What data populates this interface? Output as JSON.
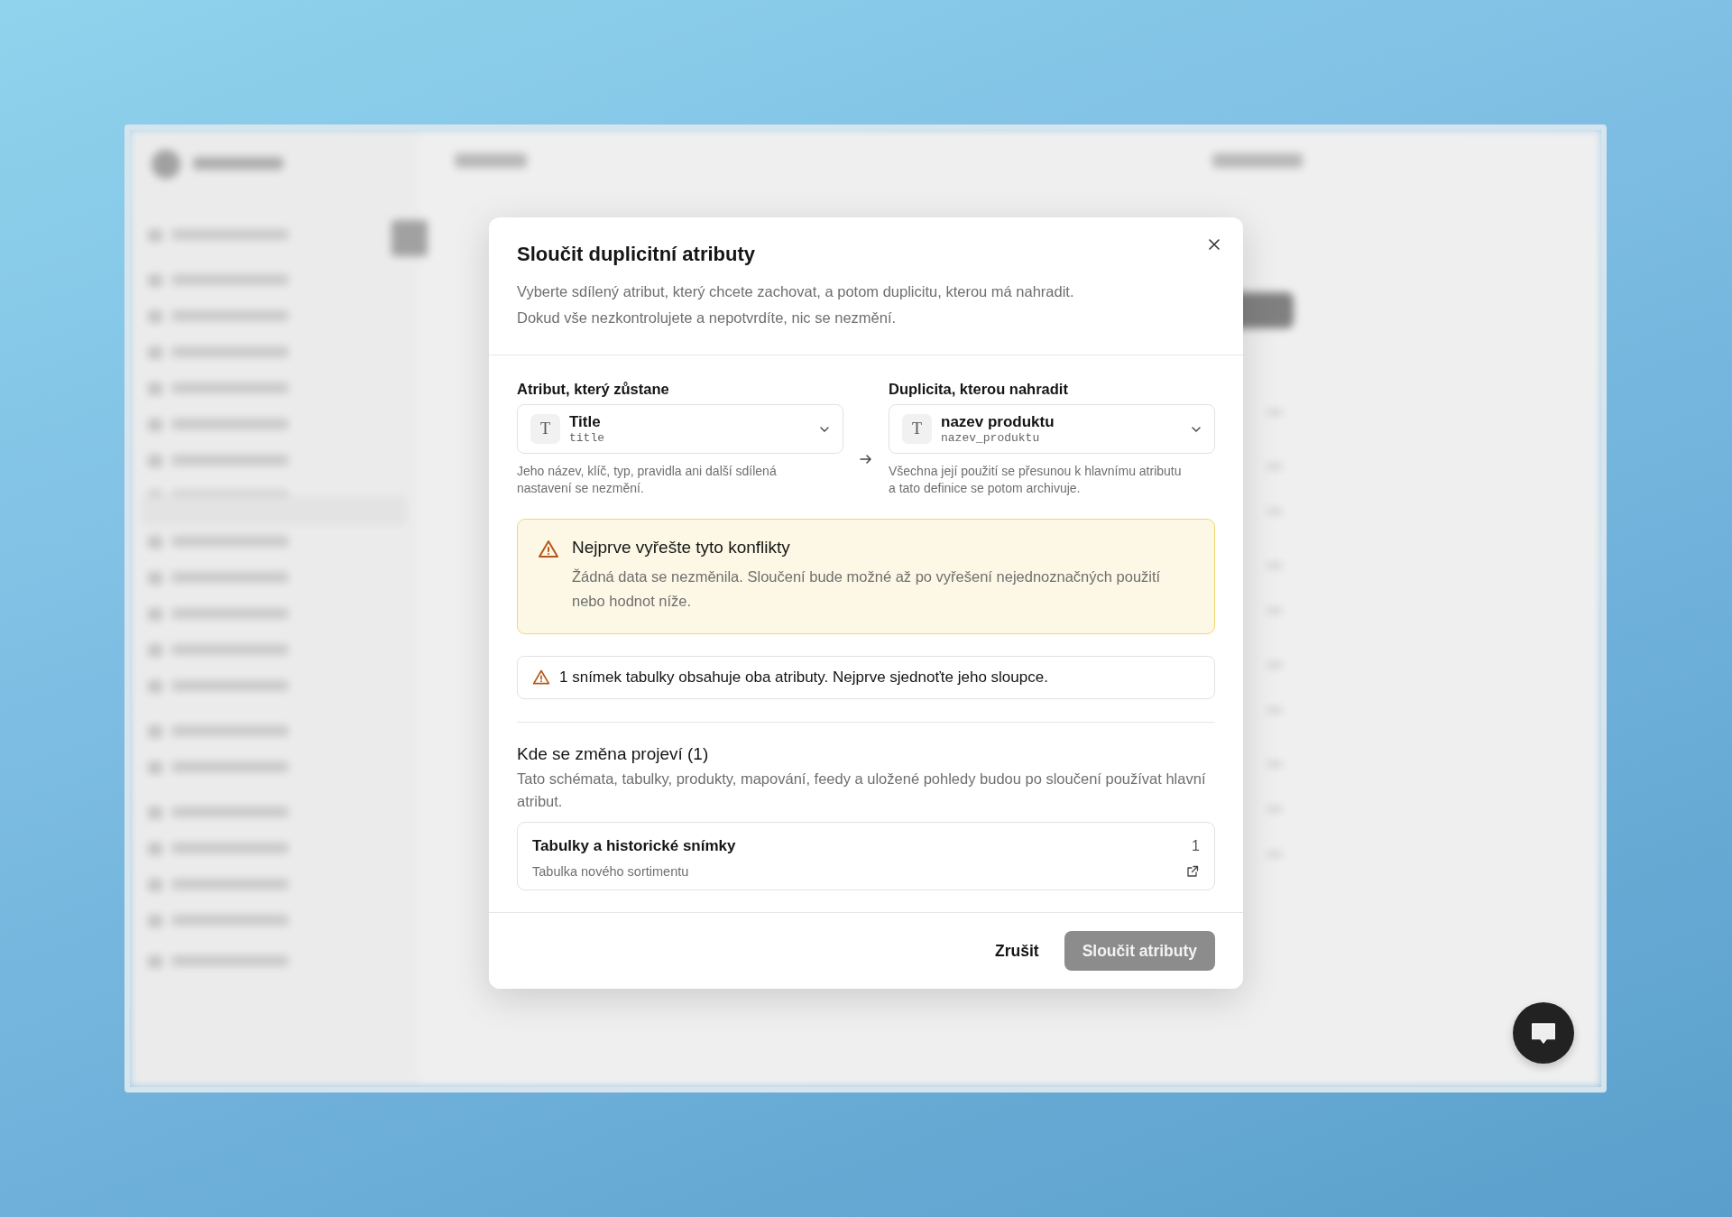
{
  "dialog": {
    "title": "Sloučit duplicitní atributy",
    "description": [
      "Vyberte sdílený atribut, který chcete zachovat, a potom duplicitu, kterou má nahradit.",
      "Dokud vše nezkontrolujete a nepotvrdíte, nic se nezmění."
    ],
    "fields": [
      {
        "label": "Atribut, který zůstane",
        "type_symbol": "T",
        "value": "Title",
        "key": "title",
        "hint": "Jeho název, klíč, typ, pravidla ani další sdílená nastavení se nezmění."
      },
      {
        "label": "Duplicita, kterou nahradit",
        "type_symbol": "T",
        "value": "nazev produktu",
        "key": "nazev_produktu",
        "hint": "Všechna její použití se přesunou k hlavnímu atributu a tato definice se potom archivuje."
      }
    ],
    "warning": {
      "title": "Nejprve vyřešte tyto konflikty",
      "message": "Žádná data se nezměnila. Sloučení bude možné až po vyřešení nejednoznačných použití nebo hodnot níže."
    },
    "conflicts": [
      "1 snímek tabulky obsahuje oba atributy. Nejprve sjednoťte jeho sloupce."
    ],
    "impact": {
      "title": "Kde se změna projeví (1)",
      "description": "Tato schémata, tabulky, produkty, mapování, feedy a uložené pohledy budou po sloučení používat hlavní atribut.",
      "groups": [
        {
          "title": "Tabulky a historické snímky",
          "count": "1",
          "items": [
            "Tabulka nového sortimentu"
          ]
        }
      ]
    },
    "cancel": "Zrušit",
    "confirm": {
      "label": "Sloučit atributy",
      "disabled": true
    }
  }
}
